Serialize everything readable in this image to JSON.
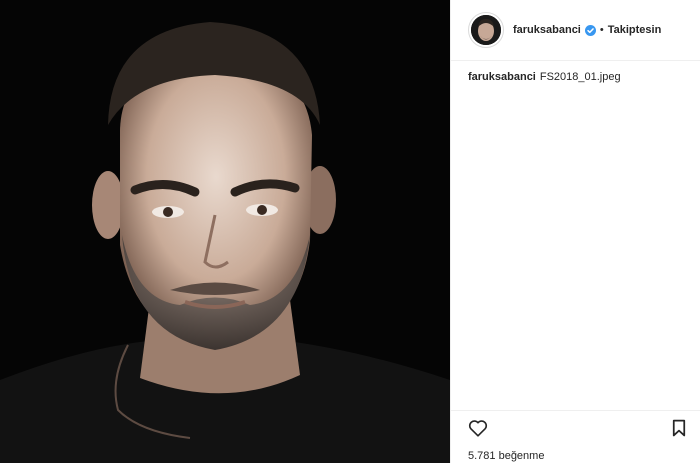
{
  "post": {
    "username": "faruksabanci",
    "follow_status": "Takiptesin",
    "separator": "•",
    "caption_user": "faruksabanci",
    "caption_text": "FS2018_01.jpeg",
    "likes": "5.781 beğenme"
  },
  "icons": {
    "verified": "verified-badge-icon",
    "like": "heart-icon",
    "save": "bookmark-icon"
  },
  "colors": {
    "verified_blue": "#3897f0",
    "photo_background": "#050505",
    "text": "#262626",
    "divider": "#efefef"
  }
}
